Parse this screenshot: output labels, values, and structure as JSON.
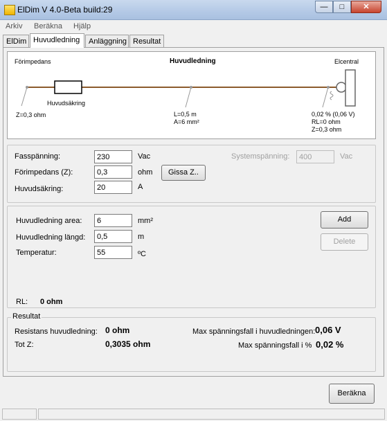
{
  "window": {
    "title": "ElDim V 4.0-Beta build:29",
    "min_glyph": "—",
    "max_glyph": "□",
    "close_glyph": "✕"
  },
  "menu": [
    "Arkiv",
    "Beräkna",
    "Hjälp"
  ],
  "tabs": [
    "ElDim",
    "Huvudledning",
    "Anläggning",
    "Resultat"
  ],
  "diagram": {
    "left_title": "Förimpedans",
    "center_title": "Huvudledning",
    "right_title": "Elcentral",
    "fuse_label": "Huvudsäkring",
    "left_value": "Z=0,3 ohm",
    "mid_l": "L=0,5 m",
    "mid_a": "A=6 mm²",
    "right_drop": "0,02 % (0,06 V)",
    "right_rl": "RL=0 ohm",
    "right_z": "Z=0,3 ohm",
    "line_color": "#8b5a2b"
  },
  "supply": {
    "fas_label": "Fasspänning:",
    "fas_value": "230",
    "fas_unit": "Vac",
    "forimp_label": "Förimpedans (Z):",
    "forimp_value": "0,3",
    "forimp_unit": "ohm",
    "gissa_button": "Gissa Z..",
    "fuse_label": "Huvudsäkring:",
    "fuse_value": "20",
    "fuse_unit": "A",
    "system_label": "Systemspänning:",
    "system_value": "400",
    "system_unit": "Vac"
  },
  "cable": {
    "area_label": "Huvudledning area:",
    "area_value": "6",
    "area_unit": "mm²",
    "length_label": "Huvudledning längd:",
    "length_value": "0,5",
    "length_unit": "m",
    "temp_label": "Temperatur:",
    "temp_value": "55",
    "temp_unit": "ºC",
    "add_button": "Add",
    "delete_button": "Delete",
    "rl_label": "RL:",
    "rl_value": "0 ohm"
  },
  "result": {
    "group_title": "Resultat",
    "resistance_label": "Resistans huvudledning:",
    "resistance_value": "0 ohm",
    "totz_label": "Tot Z:",
    "totz_value": "0,3035 ohm",
    "max_drop_v_label": "Max spänningsfall i huvudledningen:",
    "max_drop_v_value": "0,06 V",
    "max_drop_pct_label": "Max spänningsfall i %",
    "max_drop_pct_value": "0,02 %"
  },
  "footer": {
    "compute_button": "Beräkna"
  }
}
